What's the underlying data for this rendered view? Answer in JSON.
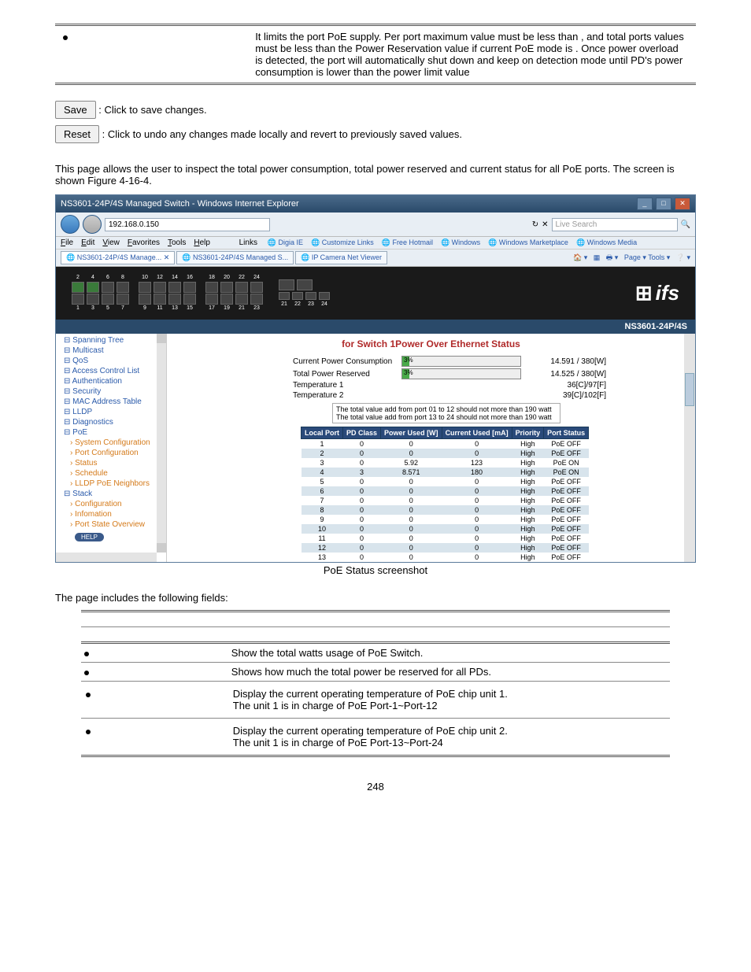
{
  "top_note": {
    "text": "It limits the port PoE supply. Per port maximum value must be less than , and total ports values must be less than the Power Reservation value if current PoE mode is . Once power overload is detected, the port will automatically shut down and keep on detection mode until PD's power consumption is lower than the power limit value"
  },
  "buttons": {
    "save": "Save",
    "save_desc": ": Click to save changes.",
    "reset": "Reset",
    "reset_desc": ": Click to undo any changes made locally and revert to previously saved values."
  },
  "intro": "This page allows the user to inspect the total power consumption, total power reserved and current status for all PoE ports. The screen is shown Figure 4-16-4.",
  "browser": {
    "title": "NS3601-24P/4S Managed Switch - Windows Internet Explorer",
    "url": "192.168.0.150",
    "search_placeholder": "Live Search",
    "menu": [
      "File",
      "Edit",
      "View",
      "Favorites",
      "Tools",
      "Help"
    ],
    "links_label": "Links",
    "links": [
      "Digia IE",
      "Customize Links",
      "Free Hotmail",
      "Windows",
      "Windows Marketplace",
      "Windows Media"
    ],
    "tabs": [
      "NS3601-24P/4S Manage...",
      "NS3601-24P/4S Managed S...",
      "IP Camera Net Viewer"
    ],
    "toolbar_right": "Page ▾   Tools ▾"
  },
  "device": {
    "logo": "ifs",
    "model": "NS3601-24P/4S",
    "ports_top": [
      "2",
      "4",
      "6",
      "8",
      "",
      "10",
      "12",
      "14",
      "16",
      "",
      "18",
      "20",
      "22",
      "24"
    ],
    "ports_bot": [
      "1",
      "3",
      "5",
      "7",
      "",
      "9",
      "11",
      "13",
      "15",
      "",
      "17",
      "19",
      "21",
      "23"
    ],
    "extra_ports": [
      "21",
      "22",
      "23",
      "24"
    ]
  },
  "sidebar": {
    "items": [
      {
        "label": "Spanning Tree",
        "cls": "sb-item"
      },
      {
        "label": "Multicast",
        "cls": "sb-item"
      },
      {
        "label": "QoS",
        "cls": "sb-item"
      },
      {
        "label": "Access Control List",
        "cls": "sb-item"
      },
      {
        "label": "Authentication",
        "cls": "sb-item"
      },
      {
        "label": "Security",
        "cls": "sb-item"
      },
      {
        "label": "MAC Address Table",
        "cls": "sb-item"
      },
      {
        "label": "LLDP",
        "cls": "sb-item"
      },
      {
        "label": "Diagnostics",
        "cls": "sb-item"
      },
      {
        "label": "PoE",
        "cls": "sb-item"
      },
      {
        "label": "System Configuration",
        "cls": "sb-item orange"
      },
      {
        "label": "Port Configuration",
        "cls": "sb-item orange"
      },
      {
        "label": "Status",
        "cls": "sb-item orange"
      },
      {
        "label": "Schedule",
        "cls": "sb-item orange"
      },
      {
        "label": "LLDP PoE Neighbors",
        "cls": "sb-item orange"
      },
      {
        "label": "Stack",
        "cls": "sb-item"
      },
      {
        "label": "Configuration",
        "cls": "sb-item orange"
      },
      {
        "label": "Infomation",
        "cls": "sb-item orange"
      },
      {
        "label": "Port State Overview",
        "cls": "sb-item orange"
      }
    ],
    "help": "HELP"
  },
  "main": {
    "heading": "for Switch 1Power Over Ethernet Status",
    "rows": [
      {
        "label": "Current Power Consumption",
        "pct": "3%",
        "val": "14.591 / 380[W]"
      },
      {
        "label": "Total Power Reserved",
        "pct": "3%",
        "val": "14.525 / 380[W]"
      },
      {
        "label": "Temperature 1",
        "pct": "",
        "val": "36[C]/97[F]"
      },
      {
        "label": "Temperature 2",
        "pct": "",
        "val": "39[C]/102[F]"
      }
    ],
    "notes": [
      "The total value add from port 01 to 12 should not more than 190 watt",
      "The total value add from port 13 to 24 should not more than 190 watt"
    ],
    "headers": [
      "Local Port",
      "PD Class",
      "Power Used [W]",
      "Current Used [mA]",
      "Priority",
      "Port Status"
    ],
    "data": [
      [
        "1",
        "0",
        "0",
        "0",
        "High",
        "PoE OFF"
      ],
      [
        "2",
        "0",
        "0",
        "0",
        "High",
        "PoE OFF"
      ],
      [
        "3",
        "0",
        "5.92",
        "123",
        "High",
        "PoE ON"
      ],
      [
        "4",
        "3",
        "8.571",
        "180",
        "High",
        "PoE ON"
      ],
      [
        "5",
        "0",
        "0",
        "0",
        "High",
        "PoE OFF"
      ],
      [
        "6",
        "0",
        "0",
        "0",
        "High",
        "PoE OFF"
      ],
      [
        "7",
        "0",
        "0",
        "0",
        "High",
        "PoE OFF"
      ],
      [
        "8",
        "0",
        "0",
        "0",
        "High",
        "PoE OFF"
      ],
      [
        "9",
        "0",
        "0",
        "0",
        "High",
        "PoE OFF"
      ],
      [
        "10",
        "0",
        "0",
        "0",
        "High",
        "PoE OFF"
      ],
      [
        "11",
        "0",
        "0",
        "0",
        "High",
        "PoE OFF"
      ],
      [
        "12",
        "0",
        "0",
        "0",
        "High",
        "PoE OFF"
      ],
      [
        "13",
        "0",
        "0",
        "0",
        "High",
        "PoE OFF"
      ]
    ]
  },
  "caption": "PoE Status screenshot",
  "fields_intro": "The page includes the following fields:",
  "fields": [
    {
      "desc": "Show the total watts usage of PoE Switch."
    },
    {
      "desc": "Shows how much the total power be reserved for all PDs."
    },
    {
      "desc": "Display the current operating temperature of PoE chip unit 1.\nThe unit 1 is in charge of PoE Port-1~Port-12"
    },
    {
      "desc": "Display the current operating temperature of PoE chip unit 2.\nThe unit 1 is in charge of PoE Port-13~Port-24"
    }
  ],
  "pagenum": "248"
}
